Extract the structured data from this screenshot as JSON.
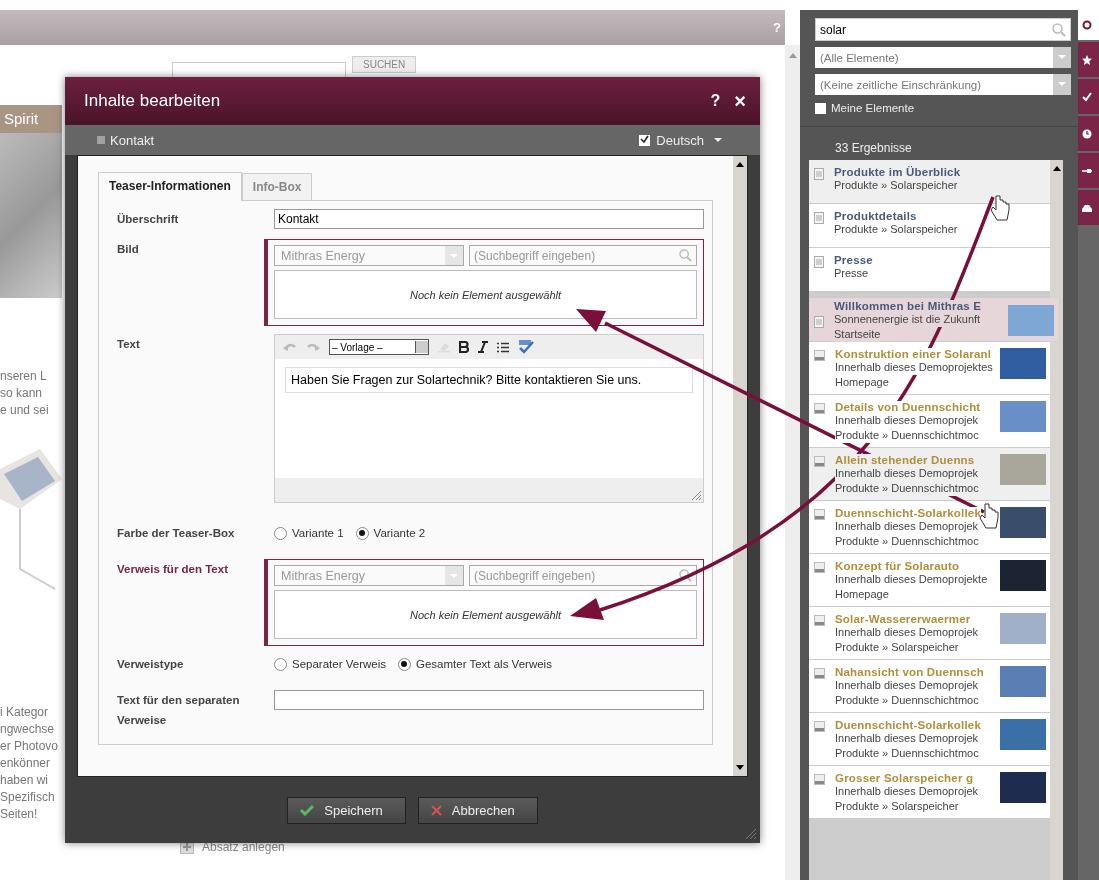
{
  "background_page": {
    "help": "?",
    "search_button": "SUCHEN",
    "banner": "Spirit",
    "fragments_top": [
      "nseren L",
      "so kann",
      "e und sei"
    ],
    "fragments_bottom": [
      "i Kategor",
      "ngwechse",
      "er Photovo",
      "enkönner",
      "haben wi",
      "Spezifisch",
      "Seiten!"
    ],
    "add_paragraph": "Absatz anlegen"
  },
  "dialog": {
    "title": "Inhalte bearbeiten",
    "help": "?",
    "close": "×",
    "breadcrumb": "Kontakt",
    "language": {
      "label": "Deutsch",
      "checked": true
    },
    "tabs": [
      {
        "label": "Teaser-Informationen",
        "selected": true
      },
      {
        "label": "Info-Box",
        "selected": false
      }
    ],
    "fields": [
      {
        "kind": "text",
        "label": "Überschrift",
        "value": "Kontakt"
      },
      {
        "kind": "reference",
        "label": "Bild",
        "highlighted": false,
        "project": "Mithras Energy",
        "placeholder": "(Suchbegriff eingeben)",
        "empty_text": "Noch kein Element ausgewählt"
      },
      {
        "kind": "richtext",
        "label": "Text",
        "style_select": "– Vorlage –",
        "value": "Haben Sie Fragen zur Solartechnik? Bitte kontaktieren Sie uns."
      },
      {
        "kind": "radio",
        "label": "Farbe der Teaser-Box",
        "options": [
          {
            "label": "Variante 1",
            "selected": false
          },
          {
            "label": "Variante 2",
            "selected": true
          }
        ]
      },
      {
        "kind": "reference",
        "label": "Verweis für den Text",
        "highlighted": true,
        "project": "Mithras Energy",
        "placeholder": "(Suchbegriff eingeben)",
        "empty_text": "Noch kein Element ausgewählt"
      },
      {
        "kind": "radio",
        "label": "Verweistype",
        "options": [
          {
            "label": "Separater Verweis",
            "selected": false
          },
          {
            "label": "Gesamter Text als Verweis",
            "selected": true
          }
        ]
      },
      {
        "kind": "text",
        "label": "Text für den separaten Verweise"
      }
    ],
    "buttons": [
      {
        "kind": "save",
        "label": "Speichern"
      },
      {
        "kind": "cancel",
        "label": "Abbrechen"
      }
    ]
  },
  "search_panel": {
    "query": "solar",
    "filters": [
      "(Alle Elemente)",
      "(Keine zeitliche Einschränkung)"
    ],
    "my_elements": {
      "label": "Meine Elemente",
      "checked": false
    },
    "count": "33 Ergebnisse",
    "results": [
      {
        "kind": "page",
        "title": "Produkte im Überblick",
        "lines": [
          "Produkte » Solarspeicher"
        ],
        "thumbnail": false,
        "selected": false,
        "hovered": true
      },
      {
        "kind": "page",
        "title": "Produktdetails",
        "lines": [
          "Produkte » Solarspeicher"
        ],
        "thumbnail": false,
        "selected": false,
        "hovered": false
      },
      {
        "kind": "page",
        "title": "Presse",
        "lines": [
          "Presse"
        ],
        "thumbnail": false,
        "selected": false,
        "hovered": false
      },
      {
        "kind": "page",
        "title": "Willkommen bei Mithras E",
        "lines": [
          "Sonnenenergie ist die Zukunft",
          "Startseite"
        ],
        "thumbnail": true,
        "selected": true,
        "hovered": false
      },
      {
        "kind": "media",
        "title": "Konstruktion einer Solaranl",
        "lines": [
          "Innerhalb dieses Demoprojektes",
          "Homepage"
        ],
        "thumbnail": true,
        "selected": false,
        "hovered": false
      },
      {
        "kind": "media",
        "title": "Details von Duennschicht",
        "lines": [
          "Innerhalb dieses Demoprojek",
          "Produkte » Duennschichtmoc"
        ],
        "thumbnail": true,
        "selected": false,
        "hovered": false
      },
      {
        "kind": "media",
        "title": "Allein stehender Duenns",
        "lines": [
          "Innerhalb dieses Demoprojek",
          "Produkte » Duennschichtmoc"
        ],
        "thumbnail": true,
        "selected": false,
        "hovered": true
      },
      {
        "kind": "media",
        "title": "Duennschicht-Solarkollek",
        "lines": [
          "Innerhalb dieses Demoprojek",
          "Produkte » Duennschichtmoc"
        ],
        "thumbnail": true,
        "selected": false,
        "hovered": false
      },
      {
        "kind": "media",
        "title": "Konzept für Solarauto",
        "lines": [
          "Innerhalb dieses Demoprojekte",
          "Homepage"
        ],
        "thumbnail": true,
        "selected": false,
        "hovered": false
      },
      {
        "kind": "media",
        "title": "Solar-Wassererwaermer",
        "lines": [
          "Innerhalb dieses Demoprojek",
          "Produkte » Solarspeicher"
        ],
        "thumbnail": true,
        "selected": false,
        "hovered": false
      },
      {
        "kind": "media",
        "title": "Nahansicht von Duennsch",
        "lines": [
          "Innerhalb dieses Demoprojek",
          "Produkte » Duennschichtmoc"
        ],
        "thumbnail": true,
        "selected": false,
        "hovered": false
      },
      {
        "kind": "media",
        "title": "Duennschicht-Solarkollek",
        "lines": [
          "Innerhalb dieses Demoprojek",
          "Produkte » Duennschichtmoc"
        ],
        "thumbnail": true,
        "selected": false,
        "hovered": false
      },
      {
        "kind": "media",
        "title": "Grosser Solarspeicher g",
        "lines": [
          "Innerhalb dieses Demoprojek",
          "Produkte » Solarspeicher"
        ],
        "thumbnail": true,
        "selected": false,
        "hovered": false
      }
    ]
  }
}
